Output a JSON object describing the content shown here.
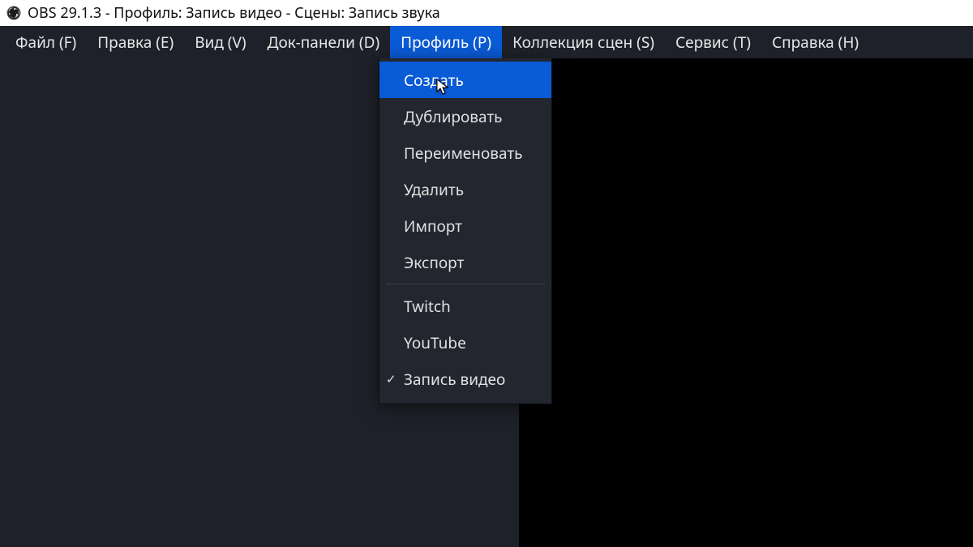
{
  "titlebar": {
    "text": "OBS 29.1.3 - Профиль: Запись видео - Сцены: Запись звука"
  },
  "menubar": {
    "items": [
      {
        "label": "Файл (F)"
      },
      {
        "label": "Правка (E)"
      },
      {
        "label": "Вид (V)"
      },
      {
        "label": "Док-панели (D)"
      },
      {
        "label": "Профиль (P)",
        "active": true
      },
      {
        "label": "Коллекция сцен (S)"
      },
      {
        "label": "Сервис (T)"
      },
      {
        "label": "Справка (H)"
      }
    ]
  },
  "dropdown": {
    "items": [
      {
        "label": "Создать",
        "highlight": true
      },
      {
        "label": "Дублировать"
      },
      {
        "label": "Переименовать"
      },
      {
        "label": "Удалить"
      },
      {
        "label": "Импорт"
      },
      {
        "label": "Экспорт"
      },
      {
        "sep": true
      },
      {
        "label": "Twitch"
      },
      {
        "label": "YouTube"
      },
      {
        "label": "Запись видео",
        "checked": true
      }
    ]
  }
}
